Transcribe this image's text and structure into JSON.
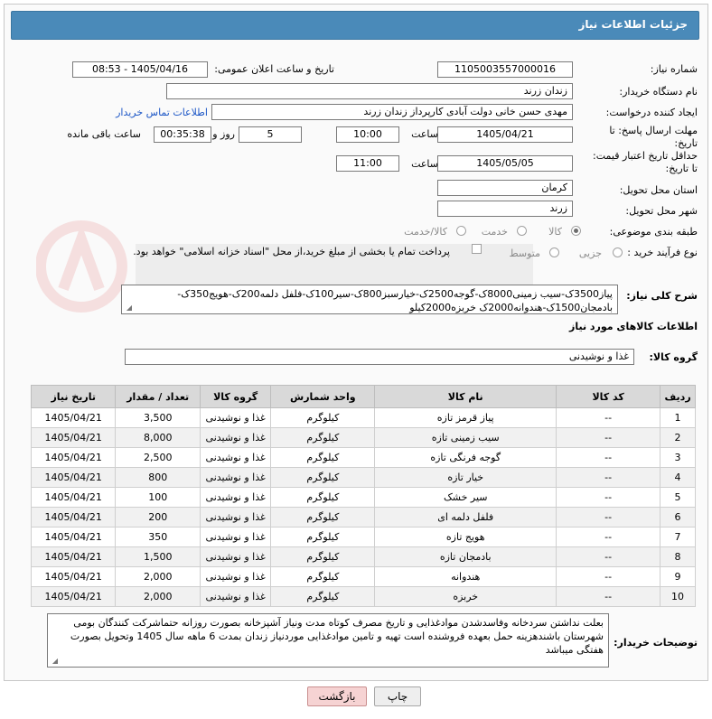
{
  "header": {
    "title": "جزئیات اطلاعات نیاز"
  },
  "form": {
    "need_number_label": "شماره نیاز:",
    "need_number": "1105003557000016",
    "announce_label": "تاریخ و ساعت اعلان عمومی:",
    "announce_value": "1405/04/16 - 08:53",
    "buyer_label": "نام دستگاه خریدار:",
    "buyer_value": "زندان زرند",
    "creator_label": "ایجاد کننده درخواست:",
    "creator_value": "مهدی حسن خانی دولت آبادی کارپرداز زندان زرند",
    "contact_link": "اطلاعات تماس خریدار",
    "deadline_label": "مهلت ارسال پاسخ: تا تاریخ:",
    "deadline_date": "1405/04/21",
    "time_label": "ساعت",
    "deadline_time": "10:00",
    "days_value": "5",
    "days_label": "روز و",
    "remaining_value": "00:35:38",
    "remaining_label": "ساعت باقی مانده",
    "validity_label": "حداقل تاریخ اعتبار قیمت: تا تاریخ:",
    "validity_date": "1405/05/05",
    "validity_time": "11:00",
    "province_label": "استان محل تحویل:",
    "province_value": "کرمان",
    "city_label": "شهر محل تحویل:",
    "city_value": "زرند",
    "category_label": "طبقه بندی موضوعی:",
    "category_options": [
      "کالا",
      "خدمت",
      "کالا/خدمت"
    ],
    "category_selected": "کالا",
    "process_label": "نوع فرآیند خرید :",
    "process_options": [
      "جزیی",
      "متوسط"
    ],
    "payment_note": "پرداخت تمام یا بخشی از مبلغ خرید،از محل \"اسناد خزانه اسلامی\" خواهد بود.",
    "summary_label": "شرح کلی نیاز:",
    "summary_value": "پیاز3500ک-سیب زمینی8000ک-گوجه2500ک-خیارسبز800ک-سیر100ک-فلفل دلمه200ک-هویج350ک-بادمجان1500ک-هندوانه2000ک خربزه2000کیلو",
    "items_title": "اطلاعات کالاهای مورد نیاز",
    "group_label": "گروه کالا:",
    "group_value": "غذا و نوشیدنی"
  },
  "table": {
    "headers": [
      "ردیف",
      "کد کالا",
      "نام کالا",
      "واحد شمارش",
      "گروه کالا",
      "تعداد / مقدار",
      "تاریخ نیاز"
    ],
    "rows": [
      [
        "1",
        "--",
        "پیاز قرمز تازه",
        "کیلوگرم",
        "غذا و نوشیدنی",
        "3,500",
        "1405/04/21"
      ],
      [
        "2",
        "--",
        "سیب زمینی تازه",
        "کیلوگرم",
        "غذا و نوشیدنی",
        "8,000",
        "1405/04/21"
      ],
      [
        "3",
        "--",
        "گوجه فرنگی تازه",
        "کیلوگرم",
        "غذا و نوشیدنی",
        "2,500",
        "1405/04/21"
      ],
      [
        "4",
        "--",
        "خیار تازه",
        "کیلوگرم",
        "غذا و نوشیدنی",
        "800",
        "1405/04/21"
      ],
      [
        "5",
        "--",
        "سیر خشک",
        "کیلوگرم",
        "غذا و نوشیدنی",
        "100",
        "1405/04/21"
      ],
      [
        "6",
        "--",
        "فلفل دلمه ای",
        "کیلوگرم",
        "غذا و نوشیدنی",
        "200",
        "1405/04/21"
      ],
      [
        "7",
        "--",
        "هویج تازه",
        "کیلوگرم",
        "غذا و نوشیدنی",
        "350",
        "1405/04/21"
      ],
      [
        "8",
        "--",
        "بادمجان تازه",
        "کیلوگرم",
        "غذا و نوشیدنی",
        "1,500",
        "1405/04/21"
      ],
      [
        "9",
        "--",
        "هندوانه",
        "کیلوگرم",
        "غذا و نوشیدنی",
        "2,000",
        "1405/04/21"
      ],
      [
        "10",
        "--",
        "خربزه",
        "کیلوگرم",
        "غذا و نوشیدنی",
        "2,000",
        "1405/04/21"
      ]
    ]
  },
  "notes": {
    "label": "توضیحات خریدار:",
    "value": "بعلت نداشتن سردخانه وفاسدشدن موادغذایی و تاریخ مصرف کوتاه مدت ونیاز آشپزخانه  بصورت روزانه حتماشرکت کنندگان بومی شهرستان باشندهزینه حمل بعهده فروشنده  است تهیه و تامین موادغذایی  موردنیاز زندان بمدت 6 ماهه سال 1405 وتحویل بصورت هفتگی میباشد"
  },
  "buttons": {
    "print": "چاپ",
    "back": "بازگشت"
  },
  "colors": {
    "header": "#4a8ab9",
    "link": "#1d57c6",
    "back_button": "#f6d3d3"
  }
}
